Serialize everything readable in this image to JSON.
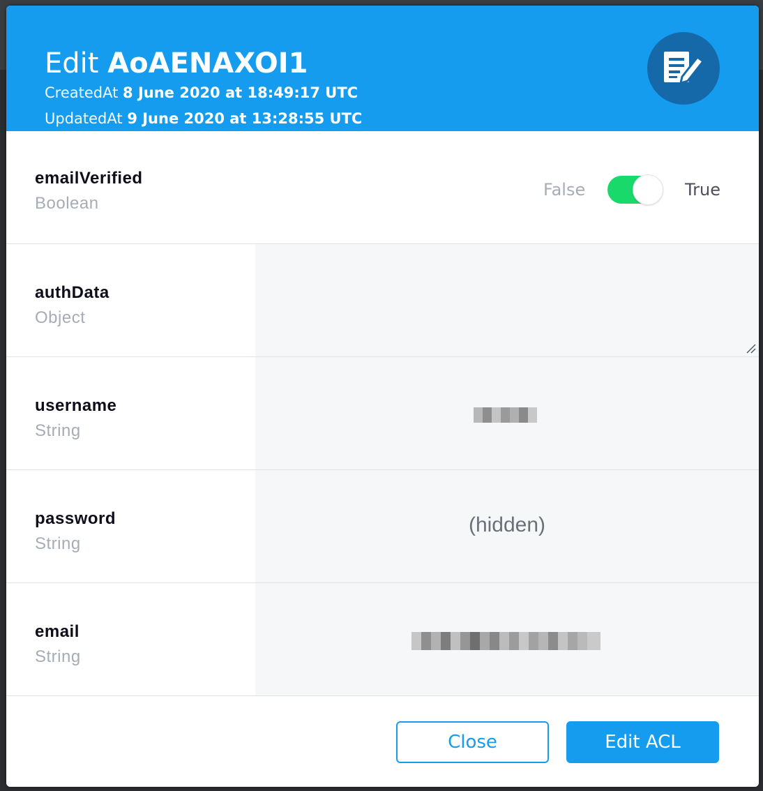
{
  "header": {
    "title_prefix": "Edit",
    "object_id": "AoAENAXOI1",
    "created_label": "CreatedAt",
    "created_value": "8 June 2020 at 18:49:17 UTC",
    "updated_label": "UpdatedAt",
    "updated_value": "9 June 2020 at 13:28:55 UTC",
    "icon": "edit-document-icon"
  },
  "fields": {
    "emailVerified": {
      "name": "emailVerified",
      "type": "Boolean",
      "false_label": "False",
      "true_label": "True",
      "value": true
    },
    "authData": {
      "name": "authData",
      "type": "Object",
      "value": ""
    },
    "username": {
      "name": "username",
      "type": "String",
      "value_state": "redacted"
    },
    "password": {
      "name": "password",
      "type": "String",
      "value": "(hidden)"
    },
    "email": {
      "name": "email",
      "type": "String",
      "value_state": "redacted"
    }
  },
  "footer": {
    "close_label": "Close",
    "edit_acl_label": "Edit ACL"
  },
  "colors": {
    "header_bg": "#169cee",
    "icon_circle": "#1669a8",
    "toggle_on": "#1ad96b",
    "value_pane_bg": "#f5f7f8"
  }
}
